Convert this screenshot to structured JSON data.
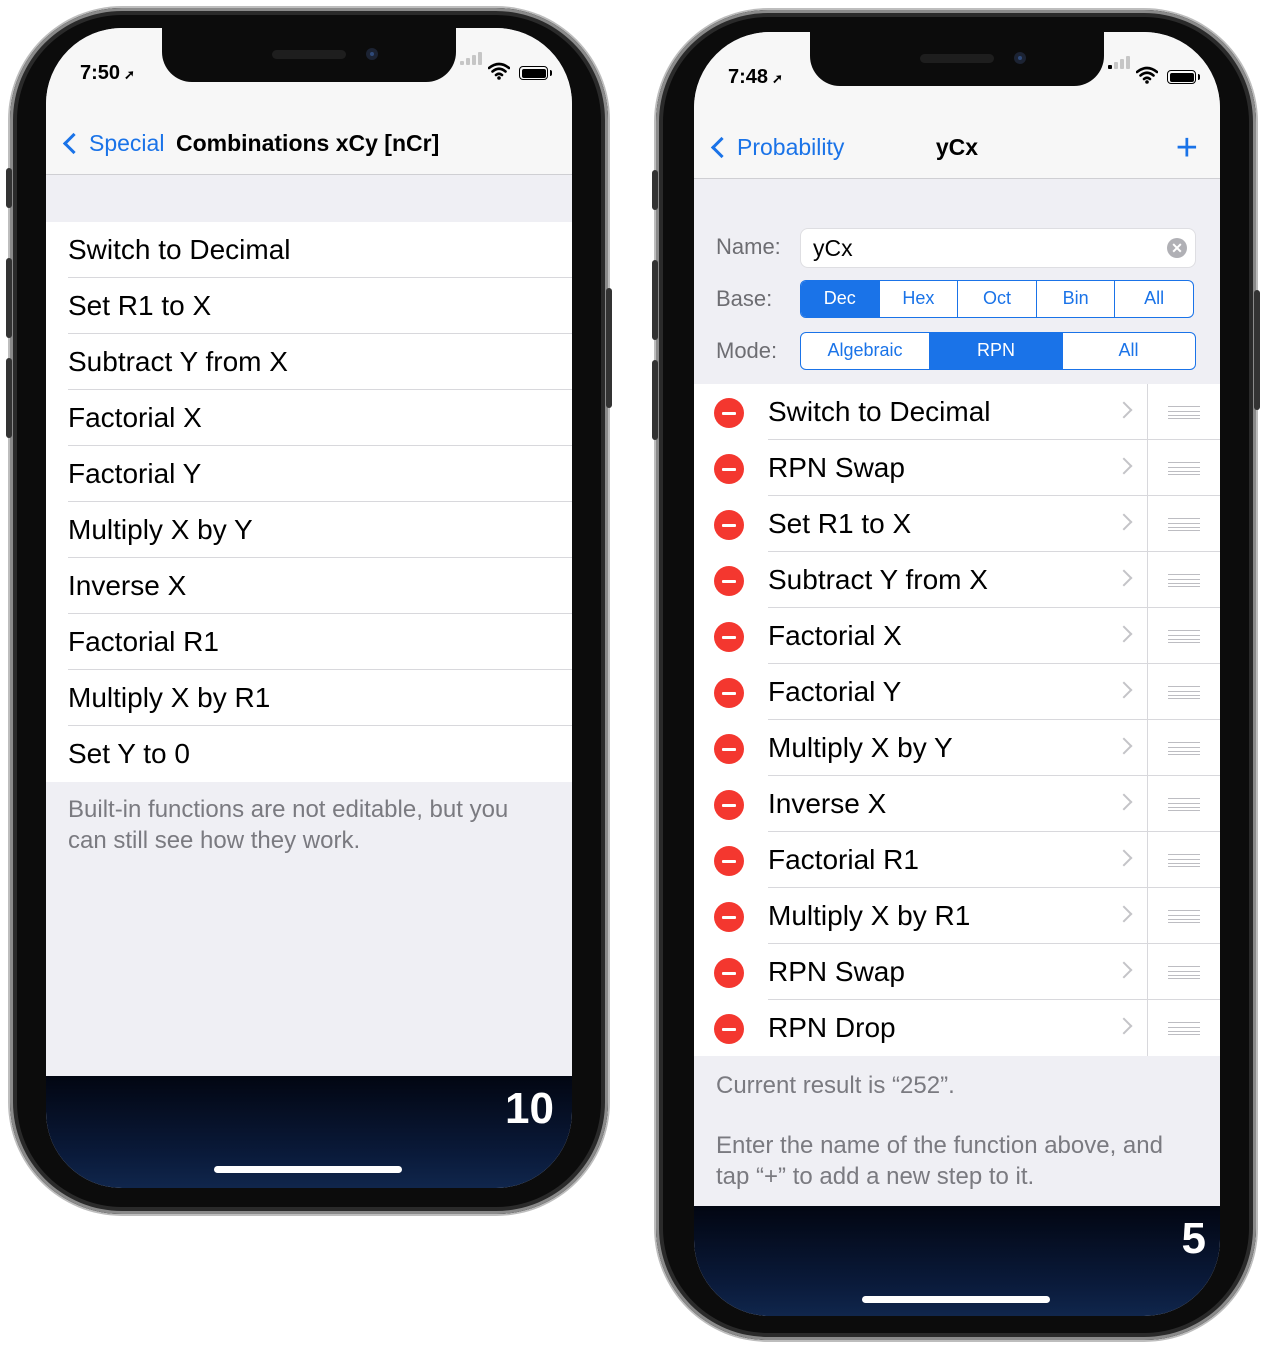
{
  "left": {
    "time": "7:50",
    "back_label": "Special",
    "title": "Combinations xCy [nCr]",
    "steps": [
      "Switch to Decimal",
      "Set R1 to X",
      "Subtract Y from X",
      "Factorial X",
      "Factorial Y",
      "Multiply X by Y",
      "Inverse X",
      "Factorial R1",
      "Multiply X by R1",
      "Set Y to 0"
    ],
    "note": "Built-in functions are not editable, but you can still see how they work.",
    "counter": "10"
  },
  "right": {
    "time": "7:48",
    "back_label": "Probability",
    "title": "yCx",
    "plus": "+",
    "name_label": "Name:",
    "name_value": "yCx",
    "base_label": "Base:",
    "base_options": [
      "Dec",
      "Hex",
      "Oct",
      "Bin",
      "All"
    ],
    "base_selected": "Dec",
    "mode_label": "Mode:",
    "mode_options": [
      "Algebraic",
      "RPN",
      "All"
    ],
    "mode_selected": "RPN",
    "steps": [
      "Switch to Decimal",
      "RPN Swap",
      "Set R1 to X",
      "Subtract Y from X",
      "Factorial X",
      "Factorial Y",
      "Multiply X by Y",
      "Inverse X",
      "Factorial R1",
      "Multiply X by R1",
      "RPN Swap",
      "RPN Drop"
    ],
    "result": "Current result is “252”.",
    "hint": "Enter the name of the function above, and tap “+” to add a new step to it.",
    "counter": "5"
  },
  "colors": {
    "accent": "#1a73e8",
    "delete": "#f4372f",
    "background": "#efeff4"
  },
  "icons": [
    "location-arrow-icon",
    "cellular-signal-icon",
    "wifi-icon",
    "battery-icon",
    "chevron-left-icon",
    "plus-icon",
    "clear-icon",
    "delete-icon",
    "chevron-right-icon",
    "reorder-icon"
  ]
}
